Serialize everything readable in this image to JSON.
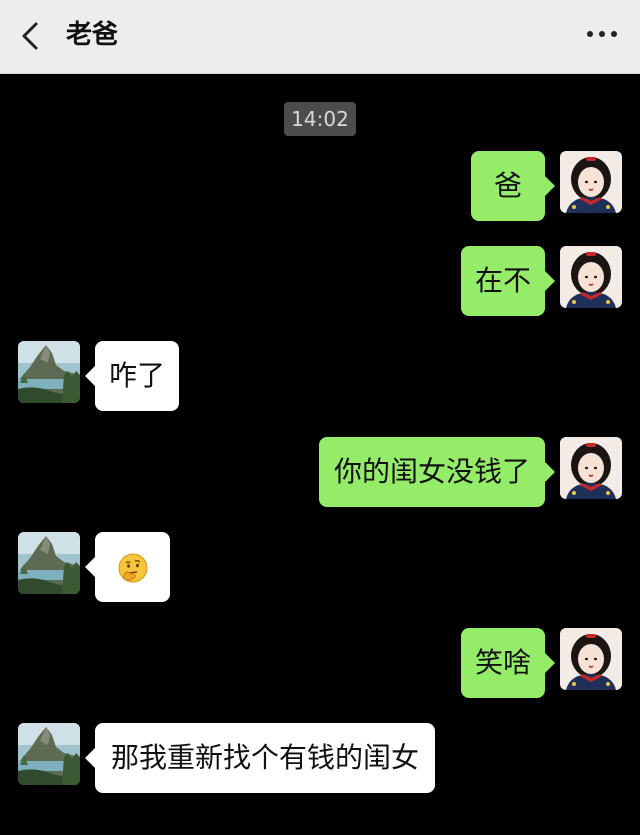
{
  "header": {
    "title": "老爸",
    "back_icon": "chevron-left-icon",
    "more_icon": "more-dots-icon"
  },
  "chat": {
    "timestamp": "14:02",
    "messages": [
      {
        "sender": "me",
        "text": "爸"
      },
      {
        "sender": "me",
        "text": "在不"
      },
      {
        "sender": "them",
        "text": "咋了"
      },
      {
        "sender": "me",
        "text": "你的闺女没钱了"
      },
      {
        "sender": "them",
        "emoji": "thinking-face-emoji"
      },
      {
        "sender": "me",
        "text": "笑啥"
      },
      {
        "sender": "them",
        "text": "那我重新找个有钱的闺女"
      }
    ]
  },
  "colors": {
    "header_bg": "#ededed",
    "chat_bg": "#000000",
    "my_bubble": "#95ec69",
    "their_bubble": "#ffffff",
    "timestamp_bg": "#4c4c4c"
  }
}
